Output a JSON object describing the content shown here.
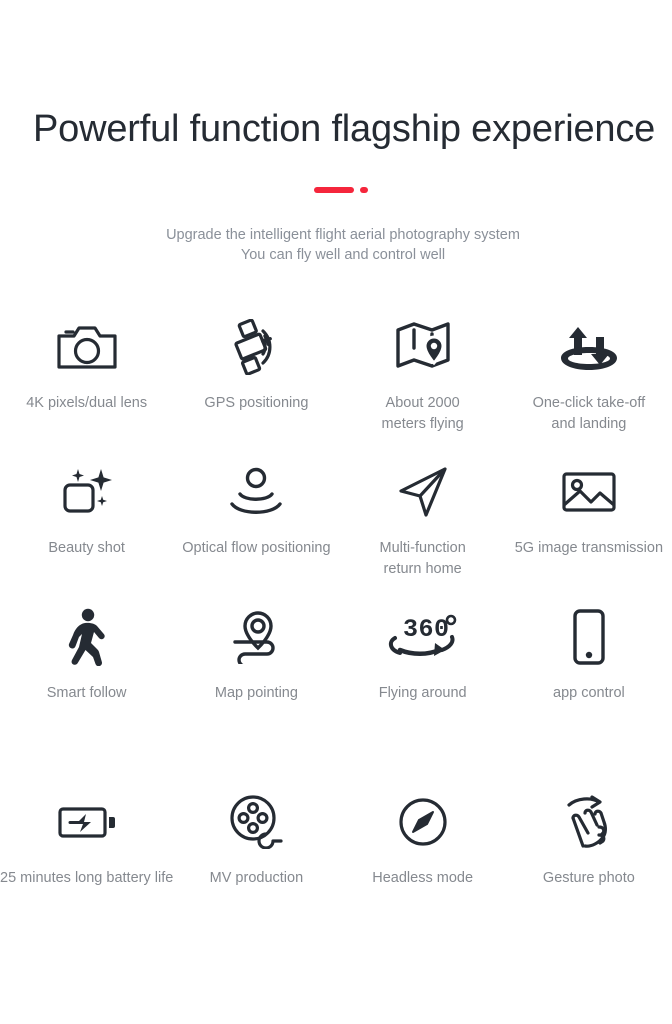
{
  "header": {
    "title": "Powerful function flagship experience",
    "accent_color": "#f5263c",
    "divider": {
      "dash_name": "red-dash",
      "dot_name": "red-dot"
    },
    "subtitle_line1": "Upgrade the intelligent flight aerial photography system",
    "subtitle_line2": "You can fly well and control well"
  },
  "features": [
    {
      "icon": "camera-icon",
      "label": "4K pixels/dual lens"
    },
    {
      "icon": "satellite-icon",
      "label": "GPS positioning"
    },
    {
      "icon": "map-pin-icon",
      "label": "About 2000\nmeters flying"
    },
    {
      "icon": "takeoff-landing-icon",
      "label": "One-click take-off\nand landing"
    },
    {
      "icon": "beauty-sparkle-icon",
      "label": "Beauty shot"
    },
    {
      "icon": "optical-flow-icon",
      "label": "Optical flow positioning"
    },
    {
      "icon": "navigation-arrow-icon",
      "label": "Multi-function\nreturn home"
    },
    {
      "icon": "image-photo-icon",
      "label": "5G image transmission"
    },
    {
      "icon": "walking-person-icon",
      "label": "Smart follow"
    },
    {
      "icon": "map-route-pin-icon",
      "label": "Map pointing"
    },
    {
      "icon": "360-rotation-icon",
      "label": "Flying around"
    },
    {
      "icon": "smartphone-icon",
      "label": "app control"
    },
    {
      "icon": "battery-charge-icon",
      "label": "25 minutes long battery life"
    },
    {
      "icon": "film-reel-icon",
      "label": "MV production"
    },
    {
      "icon": "compass-icon",
      "label": "Headless mode"
    },
    {
      "icon": "hand-gesture-icon",
      "label": "Gesture photo"
    }
  ],
  "icon_text": {
    "rotation_degrees": "360",
    "degree_symbol": "°"
  }
}
